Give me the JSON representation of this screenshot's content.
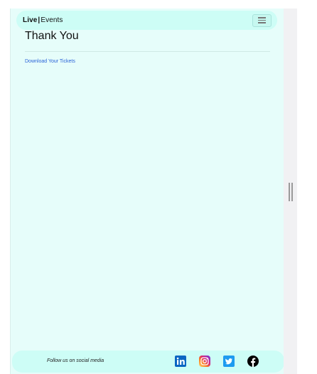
{
  "navbar": {
    "brand_live": "Live",
    "brand_separator": "|",
    "brand_events": "Events",
    "menu_icon": "hamburger-menu-icon"
  },
  "main": {
    "title": "Thank You",
    "download_link": "Download Your Tickets"
  },
  "footer": {
    "follow_text": "Follow us on social media",
    "social_icons": [
      "linkedin-icon",
      "instagram-icon",
      "twitter-icon",
      "facebook-icon"
    ]
  },
  "colors": {
    "page_background": "#e6fdfa",
    "bar_background": "#cdfdf6",
    "link": "#2a63d8",
    "linkedin": "#0a66c2",
    "twitter": "#1d9bf0",
    "facebook": "#000000"
  }
}
